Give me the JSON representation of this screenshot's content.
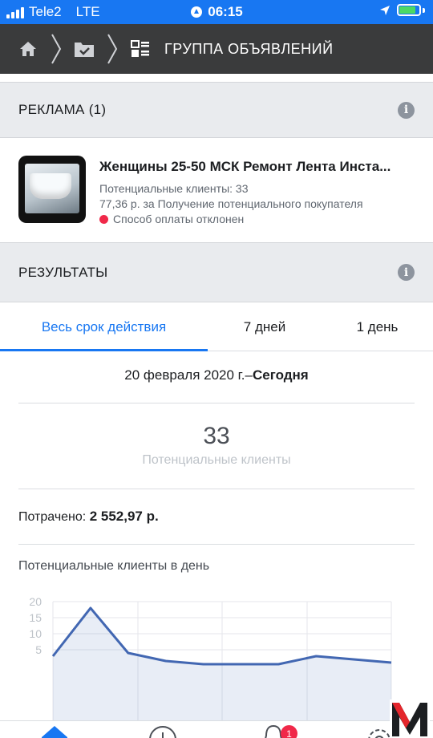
{
  "status_bar": {
    "carrier": "Tele2",
    "network": "LTE",
    "time": "06:15"
  },
  "nav": {
    "title": "ГРУППА ОБЪЯВЛЕНИЙ",
    "icons": [
      "home-icon",
      "folder-check-icon",
      "ad-set-icon"
    ]
  },
  "ads_section": {
    "title": "РЕКЛАМА (1)"
  },
  "ad": {
    "title": "Женщины 25-50 МСК Ремонт Лента Инста...",
    "leads": "Потенциальные клиенты: 33",
    "cost": "77,36 р. за Получение потенциального покупателя",
    "status": "Способ оплаты отклонен"
  },
  "results_section": {
    "title": "РЕЗУЛЬТАТЫ"
  },
  "tabs": {
    "lifetime": "Весь срок действия",
    "seven_days": "7 дней",
    "one_day": "1 день",
    "active": "lifetime"
  },
  "date_range": {
    "from": "20 февраля 2020 г.–",
    "to": "Сегодня"
  },
  "metric": {
    "value": "33",
    "label": "Потенциальные клиенты"
  },
  "spent": {
    "label": "Потрачено:",
    "value": "2 552,97 р."
  },
  "chart_data": {
    "type": "area",
    "title": "Потенциальные клиенты в день",
    "y_ticks": [
      "20",
      "15",
      "10",
      "5"
    ],
    "ylim": [
      0,
      20
    ],
    "values": [
      3,
      18,
      4,
      1.5,
      0.5,
      0.5,
      0.5,
      3,
      2,
      1
    ],
    "grid": true,
    "color": "#4267b2"
  },
  "bottom_bar": {
    "notifications_badge": "1"
  },
  "colors": {
    "accent": "#1877f2",
    "nav_bg": "#3a3b3c",
    "error": "#f02849"
  }
}
